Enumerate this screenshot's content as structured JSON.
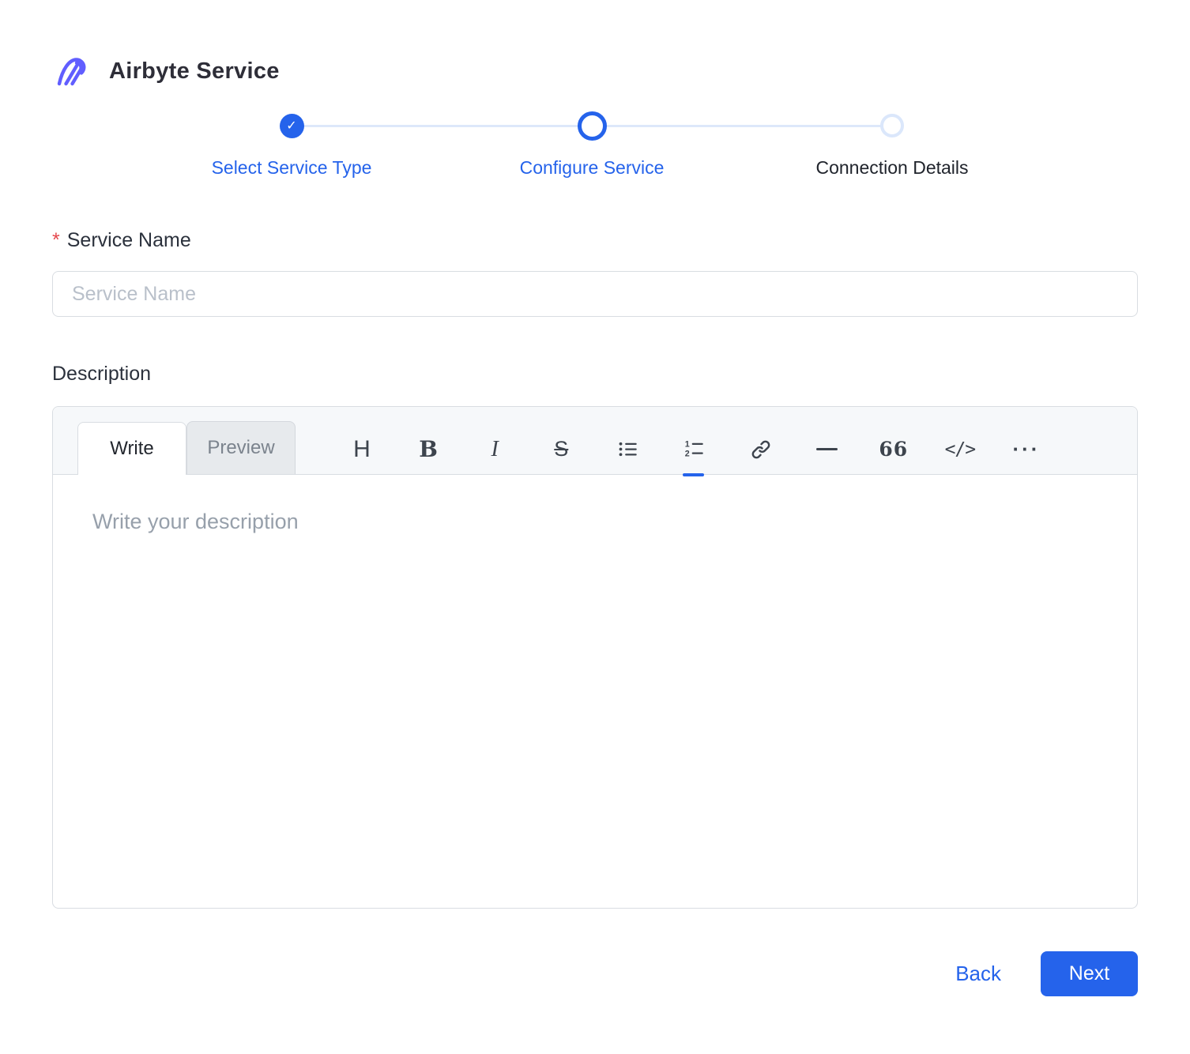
{
  "app": {
    "logo": "airbyte-logo",
    "title": "Airbyte Service"
  },
  "stepper": {
    "steps": [
      {
        "label": "Select Service Type",
        "state": "completed"
      },
      {
        "label": "Configure Service",
        "state": "active"
      },
      {
        "label": "Connection Details",
        "state": "upcoming"
      }
    ]
  },
  "form": {
    "service_name": {
      "label": "Service Name",
      "required_marker": "*",
      "placeholder": "Service Name",
      "value": ""
    },
    "description": {
      "label": "Description"
    }
  },
  "editor": {
    "tabs": [
      {
        "label": "Write",
        "active": true
      },
      {
        "label": "Preview",
        "active": false
      }
    ],
    "toolbar": [
      {
        "name": "heading",
        "glyph": "H"
      },
      {
        "name": "bold",
        "glyph": "B"
      },
      {
        "name": "italic",
        "glyph": "I"
      },
      {
        "name": "strikethrough",
        "glyph": "S"
      },
      {
        "name": "bullet-list",
        "glyph": ""
      },
      {
        "name": "ordered-list",
        "glyph": ""
      },
      {
        "name": "link",
        "glyph": ""
      },
      {
        "name": "horizontal-rule",
        "glyph": ""
      },
      {
        "name": "quote",
        "glyph": "66"
      },
      {
        "name": "code",
        "glyph": "</>"
      },
      {
        "name": "more",
        "glyph": "···"
      }
    ],
    "placeholder": "Write your description",
    "value": ""
  },
  "footer": {
    "back_label": "Back",
    "next_label": "Next"
  },
  "icons": {
    "check": "✓"
  },
  "colors": {
    "accent": "#2563eb",
    "logo_purple": "#615eff",
    "required_red": "#e5484d",
    "track_blue": "#dde8fa"
  }
}
